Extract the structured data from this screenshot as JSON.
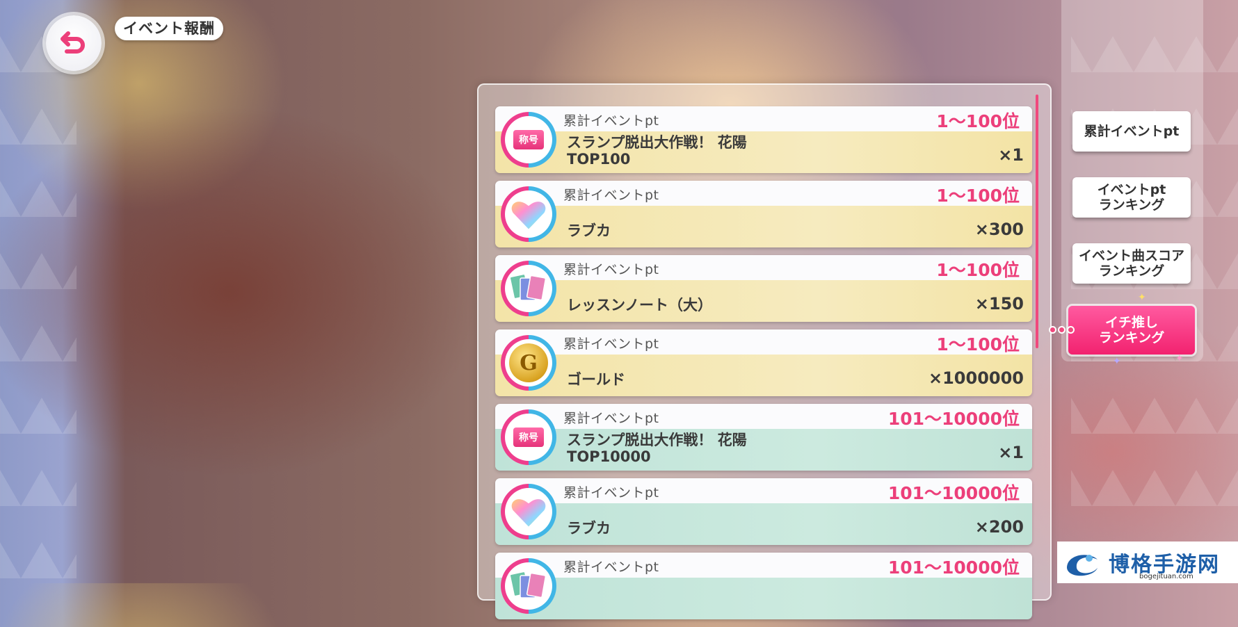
{
  "header": {
    "title": "イベント報酬"
  },
  "rewards": [
    {
      "label": "累計イベントpt",
      "rank": "1〜100位",
      "name": "スランプ脱出大作戦！ 花陽\nTOP100",
      "qty": "×1",
      "icon": "title-badge-icon",
      "icon_text": "称号",
      "tier": "gold"
    },
    {
      "label": "累計イベントpt",
      "rank": "1〜100位",
      "name": "ラブカ",
      "qty": "×300",
      "icon": "love-gem-icon",
      "tier": "gold"
    },
    {
      "label": "累計イベントpt",
      "rank": "1〜100位",
      "name": "レッスンノート（大）",
      "qty": "×150",
      "icon": "lesson-note-icon",
      "tier": "gold"
    },
    {
      "label": "累計イベントpt",
      "rank": "1〜100位",
      "name": "ゴールド",
      "qty": "×1000000",
      "icon": "gold-coin-icon",
      "icon_text": "G",
      "tier": "gold"
    },
    {
      "label": "累計イベントpt",
      "rank": "101〜10000位",
      "name": "スランプ脱出大作戦！ 花陽\nTOP10000",
      "qty": "×1",
      "icon": "title-badge-icon",
      "icon_text": "称号",
      "tier": "teal"
    },
    {
      "label": "累計イベントpt",
      "rank": "101〜10000位",
      "name": "ラブカ",
      "qty": "×200",
      "icon": "love-gem-icon",
      "tier": "teal"
    },
    {
      "label": "累計イベントpt",
      "rank": "101〜10000位",
      "name": "",
      "qty": "",
      "icon": "lesson-note-icon",
      "tier": "teal"
    }
  ],
  "tabs": [
    {
      "label": "累計イベントpt",
      "active": false
    },
    {
      "label": "イベントpt\nランキング",
      "active": false
    },
    {
      "label": "イベント曲スコア\nランキング",
      "active": false
    },
    {
      "label": "イチ推し\nランキング",
      "active": true
    }
  ],
  "watermark": {
    "text": "博格手游网",
    "sub": "bogejituan.com"
  },
  "colors": {
    "accent_pink": "#ec3f7a",
    "tab_active": "#f2226f",
    "ring_blue": "#41b6e6",
    "ring_pink": "#ee3e8d"
  }
}
